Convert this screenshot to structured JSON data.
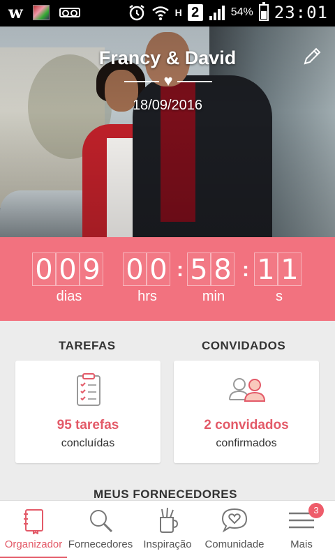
{
  "status_bar": {
    "battery_percent": "54%",
    "time": "23:01",
    "sim": "2",
    "network": "H"
  },
  "header": {
    "couple_names": "Francy & David",
    "wedding_date": "18/09/2016"
  },
  "countdown": {
    "days_digits": [
      "0",
      "0",
      "9"
    ],
    "hours_digits": [
      "0",
      "0"
    ],
    "minutes_digits": [
      "5",
      "8"
    ],
    "seconds_digits": [
      "1",
      "1"
    ],
    "labels": {
      "days": "dias",
      "hours": "hrs",
      "minutes": "min",
      "seconds": "s"
    }
  },
  "tasks": {
    "title": "TAREFAS",
    "count_text": "95 tarefas",
    "status_text": "concluídas"
  },
  "guests": {
    "title": "CONVIDADOS",
    "count_text": "2 convidados",
    "status_text": "confirmados"
  },
  "suppliers": {
    "title": "MEUS FORNECEDORES"
  },
  "bottom_nav": {
    "items": [
      {
        "label": "Organizador",
        "icon": "notebook-icon",
        "active": true
      },
      {
        "label": "Fornecedores",
        "icon": "search-icon",
        "active": false
      },
      {
        "label": "Inspiração",
        "icon": "pencil-cup-icon",
        "active": false
      },
      {
        "label": "Comunidade",
        "icon": "chat-heart-icon",
        "active": false
      },
      {
        "label": "Mais",
        "icon": "menu-icon",
        "active": false
      }
    ],
    "more_badge": "3"
  },
  "colors": {
    "accent": "#f2727f",
    "accent_text": "#e35a68",
    "background": "#ececec"
  }
}
